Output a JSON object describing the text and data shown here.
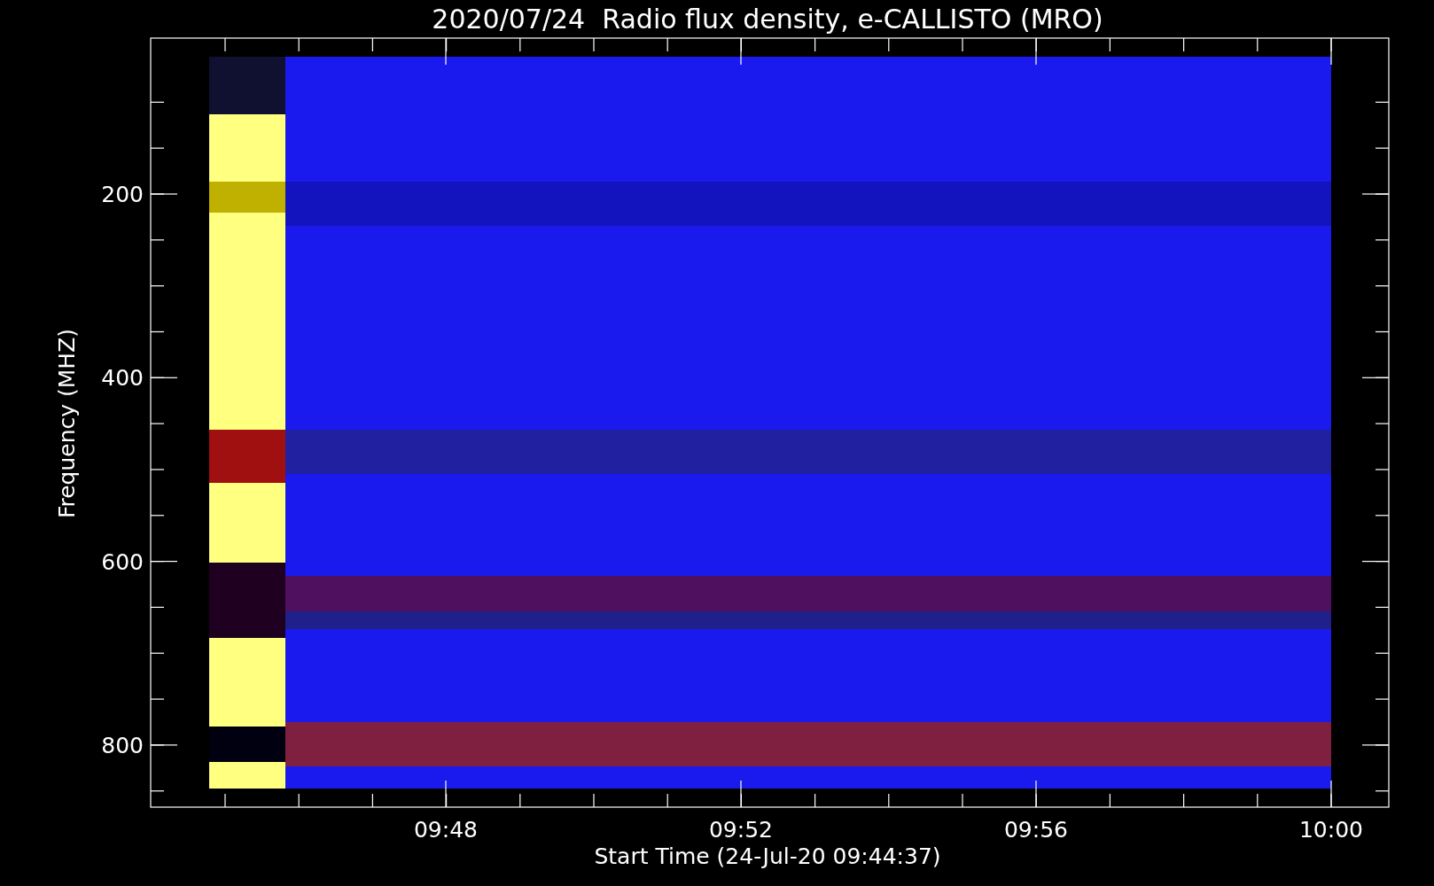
{
  "title": "2020/07/24  Radio flux density, e-CALLISTO (MRO)",
  "ylabel": "Frequency (MHZ)",
  "yticks": [
    "200",
    "400",
    "600",
    "800"
  ],
  "xticks": [
    "09:48",
    "09:52",
    "09:56",
    "10:00"
  ],
  "xlabel": "Start Time (24-Jul-20 09:44:37)"
}
